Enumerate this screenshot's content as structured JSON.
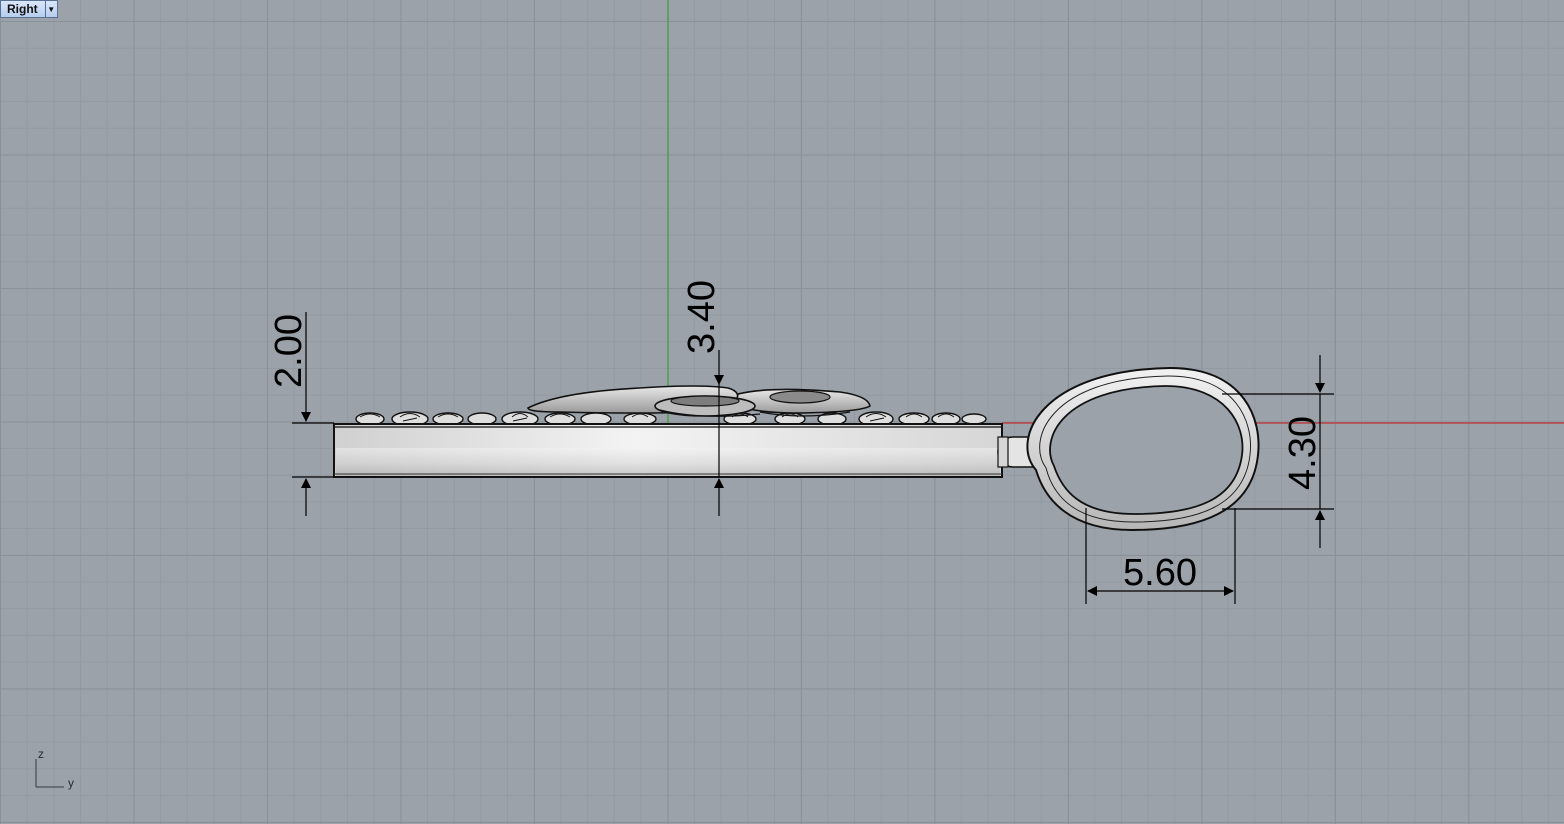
{
  "viewport": {
    "name": "Right",
    "menu_icon": "triangle-down-icon"
  },
  "dimensions": {
    "base_thickness": "2.00",
    "total_height": "3.40",
    "bail_height": "4.30",
    "bail_width": "5.60"
  },
  "axes": {
    "vertical": "z",
    "horizontal": "y"
  },
  "colors": {
    "x_axis": "#c03030",
    "z_axis": "#3aa03a",
    "grid_major": "#8a9199",
    "grid_minor": "#939aa2",
    "background": "#9ba2aa"
  }
}
